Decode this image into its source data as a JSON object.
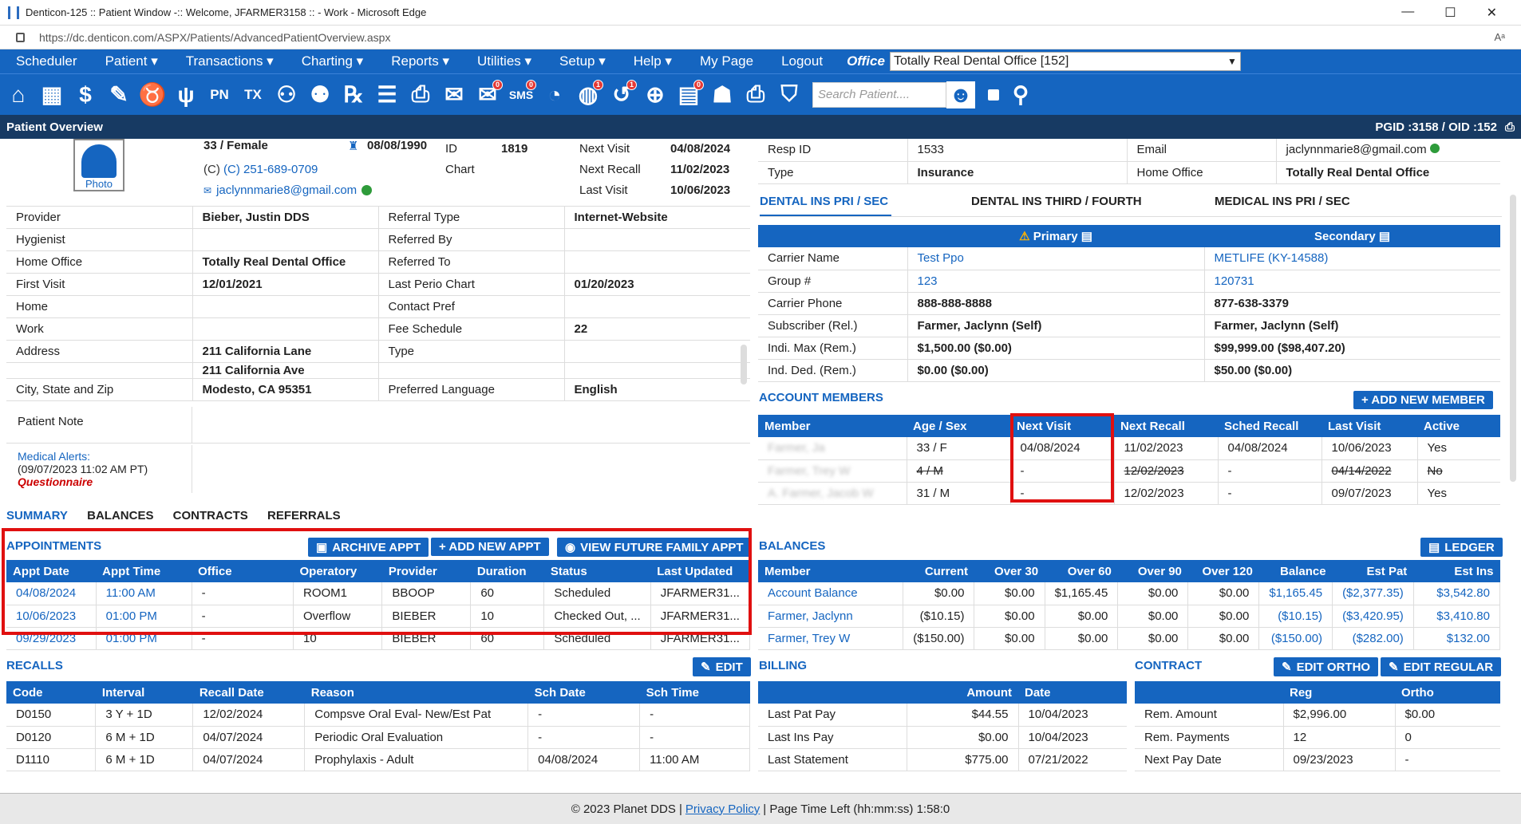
{
  "window": {
    "title": "Denticon-125 :: Patient Window -:: Welcome, JFARMER3158 :: - Work - Microsoft Edge",
    "min": "—",
    "max": "☐",
    "close": "✕"
  },
  "browser": {
    "url": "https://dc.denticon.com/ASPX/Patients/AdvancedPatientOverview.aspx"
  },
  "menu": {
    "items": [
      "Scheduler",
      "Patient ▾",
      "Transactions ▾",
      "Charting ▾",
      "Reports ▾",
      "Utilities ▾",
      "Setup ▾",
      "Help ▾",
      "My Page",
      "Logout"
    ],
    "office_label": "Office",
    "office_value": "Totally Real Dental Office [152]"
  },
  "toolbar": {
    "search_placeholder": "Search Patient....",
    "badges": {
      "sms": "0",
      "globe": "1",
      "clock2": "1",
      "report": "0"
    }
  },
  "overview": {
    "title": "Patient Overview",
    "pgid": "PGID :3158  /  OID :152"
  },
  "patient": {
    "photo_label": "Photo",
    "age_sex": "33 / Female",
    "dob": "08/08/1990",
    "id_label": "ID",
    "id_value": "1819",
    "chart_label": "Chart",
    "phone": "(C) 251-689-0709",
    "email": "jaclynnmarie8@gmail.com",
    "next_visit_label": "Next Visit",
    "next_visit": "04/08/2024",
    "next_recall_label": "Next Recall",
    "next_recall": "11/02/2023",
    "last_visit_label": "Last Visit",
    "last_visit": "10/06/2023"
  },
  "details": [
    {
      "l1": "Provider",
      "v1": "Bieber, Justin DDS",
      "l2": "Referral Type",
      "v2": "Internet-Website"
    },
    {
      "l1": "Hygienist",
      "v1": "",
      "l2": "Referred By",
      "v2": ""
    },
    {
      "l1": "Home Office",
      "v1": "Totally Real Dental Office",
      "l2": "Referred To",
      "v2": ""
    },
    {
      "l1": "First Visit",
      "v1": "12/01/2021",
      "l2": "Last Perio Chart",
      "v2": "01/20/2023"
    },
    {
      "l1": "Home",
      "v1": "",
      "l2": "Contact Pref",
      "v2": ""
    },
    {
      "l1": "Work",
      "v1": "",
      "l2": "Fee Schedule",
      "v2": "22"
    },
    {
      "l1": "Address",
      "v1": "211 California Lane",
      "l2": "Type",
      "v2": ""
    },
    {
      "l1": "",
      "v1": "211 California Ave",
      "l2": "",
      "v2": ""
    },
    {
      "l1": "City, State and Zip",
      "v1": "Modesto, CA 95351",
      "l2": "Preferred Language",
      "v2": "English"
    }
  ],
  "patient_note_label": "Patient Note",
  "medical": {
    "title": "Medical Alerts:",
    "time": "(09/07/2023 11:02 AM PT)",
    "q": "Questionnaire"
  },
  "resp": {
    "resp_id_label": "Resp ID",
    "resp_id": "1533",
    "email_label": "Email",
    "email": "jaclynnmarie8@gmail.com",
    "type_label": "Type",
    "type": "Insurance",
    "home_office_label": "Home Office",
    "home_office": "Totally Real Dental Office"
  },
  "ins_tabs": [
    "DENTAL INS PRI / SEC",
    "DENTAL INS THIRD / FOURTH",
    "MEDICAL INS PRI / SEC"
  ],
  "ins": {
    "primary": "Primary",
    "secondary": "Secondary",
    "rows": [
      {
        "l": "Carrier Name",
        "p": "Test Ppo",
        "s": "METLIFE (KY-14588)"
      },
      {
        "l": "Group #",
        "p": "123",
        "s": "120731"
      },
      {
        "l": "Carrier Phone",
        "p": "888-888-8888",
        "s": "877-638-3379"
      },
      {
        "l": "Subscriber (Rel.)",
        "p": "Farmer, Jaclynn (Self)",
        "s": "Farmer, Jaclynn (Self)"
      },
      {
        "l": "Indi. Max (Rem.)",
        "p": "$1,500.00 ($0.00)",
        "s": "$99,999.00 ($98,407.20)"
      },
      {
        "l": "Ind. Ded. (Rem.)",
        "p": "$0.00 ($0.00)",
        "s": "$50.00 ($0.00)"
      }
    ]
  },
  "members": {
    "title": "ACCOUNT MEMBERS",
    "add_btn": "+ ADD NEW MEMBER",
    "headers": [
      "Member",
      "Age / Sex",
      "Next Visit",
      "Next Recall",
      "Sched Recall",
      "Last Visit",
      "Active"
    ],
    "rows": [
      {
        "m": "Farmer, Ja",
        "a": "33 / F",
        "nv": "04/08/2024",
        "nr": "11/02/2023",
        "sr": "04/08/2024",
        "lv": "10/06/2023",
        "ac": "Yes",
        "strike": false
      },
      {
        "m": "Farmer, Trey W",
        "a": "4 / M",
        "nv": "-",
        "nr": "12/02/2023",
        "sr": "-",
        "lv": "04/14/2022",
        "ac": "No",
        "strike": true
      },
      {
        "m": "A. Farmer, Jacob W",
        "a": "31 / M",
        "nv": "-",
        "nr": "12/02/2023",
        "sr": "-",
        "lv": "09/07/2023",
        "ac": "Yes",
        "strike": false
      }
    ]
  },
  "sum_tabs": [
    "SUMMARY",
    "BALANCES",
    "CONTRACTS",
    "REFERRALS"
  ],
  "appts": {
    "title": "APPOINTMENTS",
    "archive": "ARCHIVE APPT",
    "add": "+ ADD NEW APPT",
    "future": "VIEW FUTURE FAMILY APPT",
    "headers": [
      "Appt Date",
      "Appt Time",
      "Office",
      "Operatory",
      "Provider",
      "Duration",
      "Status",
      "Last Updated"
    ],
    "rows": [
      [
        "04/08/2024",
        "11:00 AM",
        "-",
        "ROOM1",
        "BBOOP",
        "60",
        "Scheduled",
        "JFARMER31..."
      ],
      [
        "10/06/2023",
        "01:00 PM",
        "-",
        "Overflow",
        "BIEBER",
        "10",
        "Checked Out, ...",
        "JFARMER31..."
      ],
      [
        "09/29/2023",
        "01:00 PM",
        "-",
        "10",
        "BIEBER",
        "60",
        "Scheduled",
        "JFARMER31..."
      ]
    ]
  },
  "balances": {
    "title": "BALANCES",
    "ledger": "LEDGER",
    "headers": [
      "Member",
      "Current",
      "Over 30",
      "Over 60",
      "Over 90",
      "Over 120",
      "Balance",
      "Est Pat",
      "Est Ins"
    ],
    "rows": [
      [
        "Account Balance",
        "$0.00",
        "$0.00",
        "$1,165.45",
        "$0.00",
        "$0.00",
        "$1,165.45",
        "($2,377.35)",
        "$3,542.80"
      ],
      [
        "Farmer, Jaclynn",
        "($10.15)",
        "$0.00",
        "$0.00",
        "$0.00",
        "$0.00",
        "($10.15)",
        "($3,420.95)",
        "$3,410.80"
      ],
      [
        "Farmer, Trey W",
        "($150.00)",
        "$0.00",
        "$0.00",
        "$0.00",
        "$0.00",
        "($150.00)",
        "($282.00)",
        "$132.00"
      ]
    ]
  },
  "recalls": {
    "title": "RECALLS",
    "edit": "EDIT",
    "headers": [
      "Code",
      "Interval",
      "Recall Date",
      "Reason",
      "Sch Date",
      "Sch Time"
    ],
    "rows": [
      [
        "D0150",
        "3 Y + 1D",
        "12/02/2024",
        "Compsve Oral Eval- New/Est Pat",
        "-",
        "-"
      ],
      [
        "D0120",
        "6 M + 1D",
        "04/07/2024",
        "Periodic Oral Evaluation",
        "-",
        "-"
      ],
      [
        "D1110",
        "6 M + 1D",
        "04/07/2024",
        "Prophylaxis - Adult",
        "04/08/2024",
        "11:00 AM"
      ]
    ]
  },
  "billing": {
    "title": "BILLING",
    "headers": [
      "Amount",
      "Date"
    ],
    "rows": [
      [
        "Last Pat Pay",
        "$44.55",
        "10/04/2023"
      ],
      [
        "Last Ins Pay",
        "$0.00",
        "10/04/2023"
      ],
      [
        "Last Statement",
        "$775.00",
        "07/21/2022"
      ]
    ]
  },
  "contract": {
    "title": "CONTRACT",
    "edit_ortho": "EDIT ORTHO",
    "edit_regular": "EDIT REGULAR",
    "headers": [
      "Reg",
      "Ortho"
    ],
    "rows": [
      [
        "Rem. Amount",
        "$2,996.00",
        "$0.00"
      ],
      [
        "Rem. Payments",
        "12",
        "0"
      ],
      [
        "Next Pay Date",
        "09/23/2023",
        "-"
      ]
    ]
  },
  "footer": {
    "copy": "© 2023 Planet DDS |",
    "privacy": "Privacy Policy",
    "time": "| Page Time Left (hh:mm:ss) 1:58:0"
  }
}
